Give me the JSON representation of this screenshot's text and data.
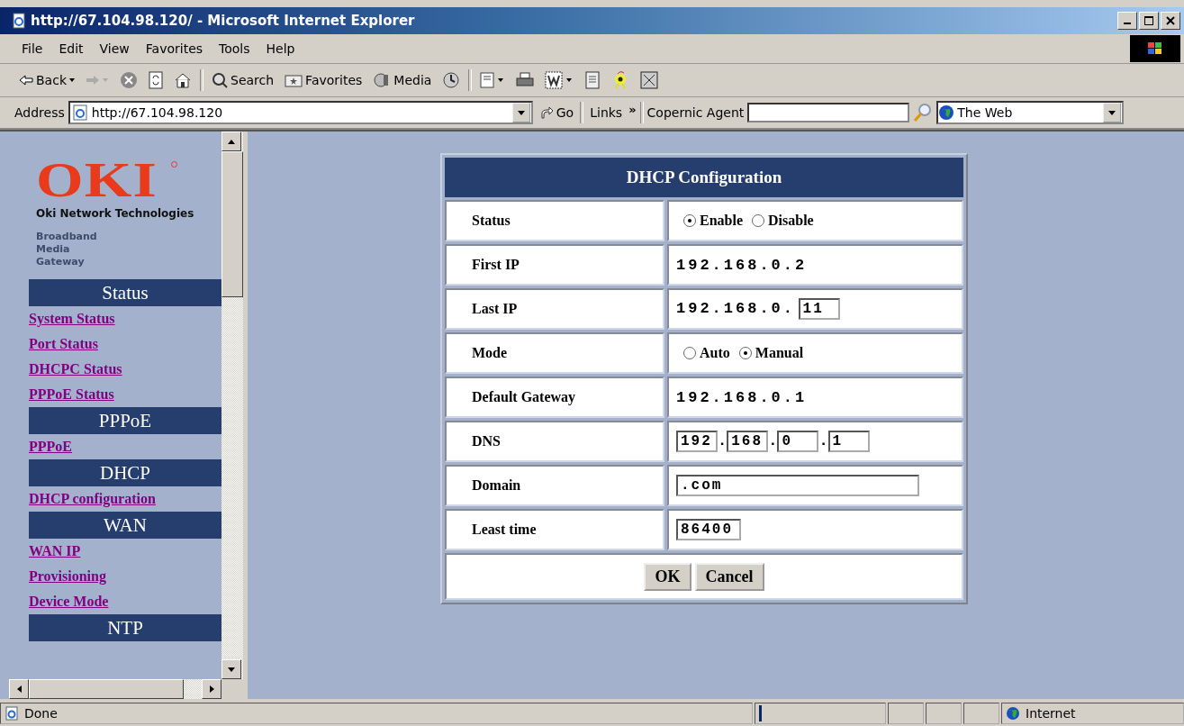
{
  "window": {
    "title": "http://67.104.98.120/ - Microsoft Internet Explorer"
  },
  "menu": [
    "File",
    "Edit",
    "View",
    "Favorites",
    "Tools",
    "Help"
  ],
  "toolbar": [
    {
      "kind": "back",
      "label": "Back"
    },
    {
      "kind": "forward"
    },
    {
      "kind": "stop"
    },
    {
      "kind": "refresh"
    },
    {
      "kind": "home"
    },
    {
      "kind": "sep"
    },
    {
      "kind": "search",
      "label": "Search"
    },
    {
      "kind": "favorites",
      "label": "Favorites"
    },
    {
      "kind": "media",
      "label": "Media"
    },
    {
      "kind": "history"
    },
    {
      "kind": "sep"
    },
    {
      "kind": "mail"
    },
    {
      "kind": "print"
    },
    {
      "kind": "edit"
    },
    {
      "kind": "doc"
    },
    {
      "kind": "bug"
    },
    {
      "kind": "grid"
    }
  ],
  "address": {
    "label": "Address",
    "value": "http://67.104.98.120",
    "go": "Go",
    "links": "Links",
    "links_more": "»",
    "agent_label": "Copernic Agent",
    "search_scope": "The Web"
  },
  "sidebar": {
    "brand": "OKI",
    "brand_sub": "Oki Network Technologies",
    "product": [
      "Broadband",
      "Media",
      "Gateway"
    ],
    "sections": [
      {
        "heading": "Status",
        "links": [
          "System Status",
          "Port Status",
          "DHCPC Status",
          "PPPoE Status"
        ]
      },
      {
        "heading": "PPPoE",
        "links": [
          "PPPoE"
        ]
      },
      {
        "heading": "DHCP",
        "links": [
          "DHCP configuration"
        ]
      },
      {
        "heading": "WAN",
        "links": [
          "WAN IP",
          "Provisioning",
          "Device Mode"
        ]
      },
      {
        "heading": "NTP"
      }
    ]
  },
  "form": {
    "title": "DHCP Configuration",
    "rows": [
      {
        "label": "Status",
        "kind": "radio",
        "options": [
          {
            "label": "Enable",
            "selected": true
          },
          {
            "label": "Disable",
            "selected": false
          }
        ]
      },
      {
        "label": "First IP",
        "kind": "text",
        "value": "192.168.0.2"
      },
      {
        "label": "Last IP",
        "kind": "prefix_input",
        "prefix": "192.168.0.",
        "value": "11"
      },
      {
        "label": "Mode",
        "kind": "radio",
        "options": [
          {
            "label": "Auto",
            "selected": false
          },
          {
            "label": "Manual",
            "selected": true
          }
        ]
      },
      {
        "label": "Default Gateway",
        "kind": "text",
        "value": "192.168.0.1"
      },
      {
        "label": "DNS",
        "kind": "octets",
        "separator": ".",
        "values": [
          "192",
          "168",
          "0",
          "1"
        ]
      },
      {
        "label": "Domain",
        "kind": "input",
        "value": ".com",
        "wide": true
      },
      {
        "label": "Least time",
        "kind": "input",
        "value": "86400",
        "wide": false
      }
    ],
    "buttons": [
      "OK",
      "Cancel"
    ]
  },
  "status_bar": {
    "text": "Done",
    "progress": {
      "level": 0.02
    },
    "zone": "Internet"
  }
}
